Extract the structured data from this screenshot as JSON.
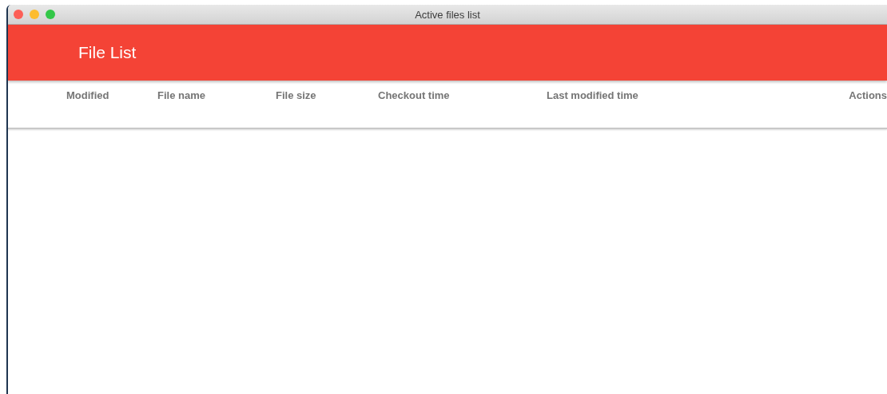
{
  "window": {
    "title": "Active files list"
  },
  "app_bar": {
    "title": "File List"
  },
  "table": {
    "columns": [
      "Modified",
      "File name",
      "File size",
      "Checkout time",
      "Last modified time",
      "Actions"
    ]
  }
}
